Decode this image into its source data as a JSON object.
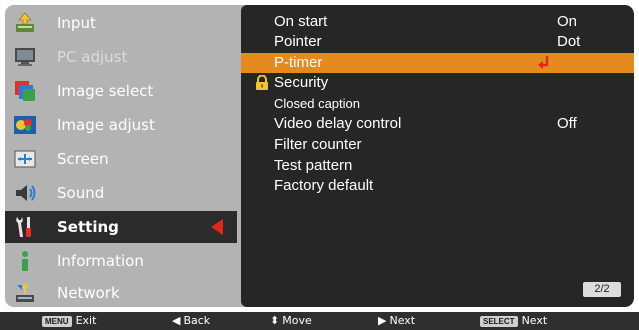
{
  "menu": {
    "items": [
      {
        "label": "Input",
        "icon": "input-icon",
        "state": "normal"
      },
      {
        "label": "PC adjust",
        "icon": "pc-adjust-icon",
        "state": "dim"
      },
      {
        "label": "Image select",
        "icon": "image-select-icon",
        "state": "normal"
      },
      {
        "label": "Image adjust",
        "icon": "image-adjust-icon",
        "state": "normal"
      },
      {
        "label": "Screen",
        "icon": "screen-icon",
        "state": "normal"
      },
      {
        "label": "Sound",
        "icon": "sound-icon",
        "state": "normal"
      },
      {
        "label": "Setting",
        "icon": "setting-icon",
        "state": "selected"
      },
      {
        "label": "Information",
        "icon": "information-icon",
        "state": "normal"
      },
      {
        "label": "Network",
        "icon": "network-icon",
        "state": "normal"
      }
    ]
  },
  "settings": {
    "items": [
      {
        "label": "On start",
        "value": "On"
      },
      {
        "label": "Pointer",
        "value": "Dot"
      },
      {
        "label": "P-timer",
        "value": "",
        "highlight": true
      },
      {
        "label": "Security",
        "value": ""
      },
      {
        "label": "Closed caption",
        "value": ""
      },
      {
        "label": "Video delay control",
        "value": "Off"
      },
      {
        "label": "Filter counter",
        "value": ""
      },
      {
        "label": "Test pattern",
        "value": ""
      },
      {
        "label": "Factory default",
        "value": ""
      }
    ],
    "page": "2/2"
  },
  "bottom_bar": {
    "exit": {
      "badge": "MENU",
      "label": "Exit"
    },
    "back": {
      "glyph": "◀",
      "label": "Back"
    },
    "move": {
      "glyph": "⬍",
      "label": "Move"
    },
    "next": {
      "glyph": "▶",
      "label": "Next"
    },
    "select": {
      "badge": "SELECT",
      "label": "Next"
    }
  },
  "colors": {
    "menu_bg": "#b3b3b3",
    "panel_bg": "#262626",
    "highlight": "#e58a1e",
    "selected_row": "#2b2b2b",
    "accent_red": "#e1261c"
  }
}
